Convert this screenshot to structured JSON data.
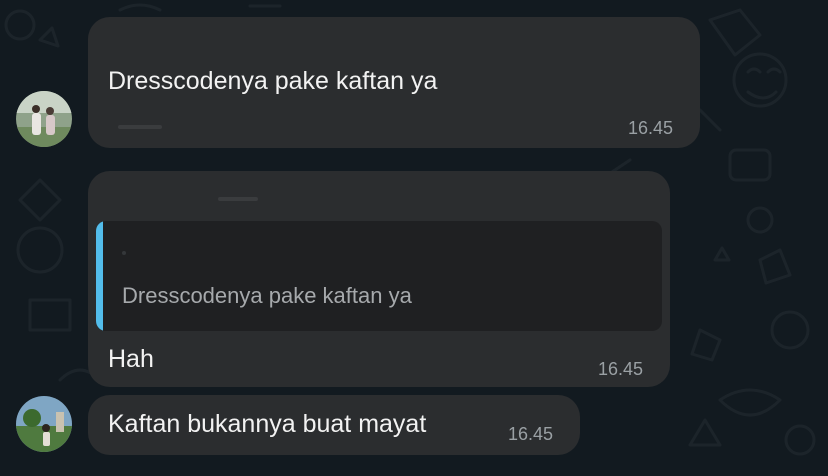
{
  "messages": [
    {
      "text": "Dresscodenya pake kaftan ya",
      "time": "16.45"
    },
    {
      "quoted_text": "Dresscodenya pake kaftan ya",
      "text": "Hah",
      "time": "16.45"
    },
    {
      "text": "Kaftan bukannya buat mayat",
      "time": "16.45"
    }
  ],
  "colors": {
    "background": "#121a20",
    "bubble": "#2b2d2f",
    "quote_bar": "#53bdeb",
    "timestamp": "#9aa0a4"
  }
}
